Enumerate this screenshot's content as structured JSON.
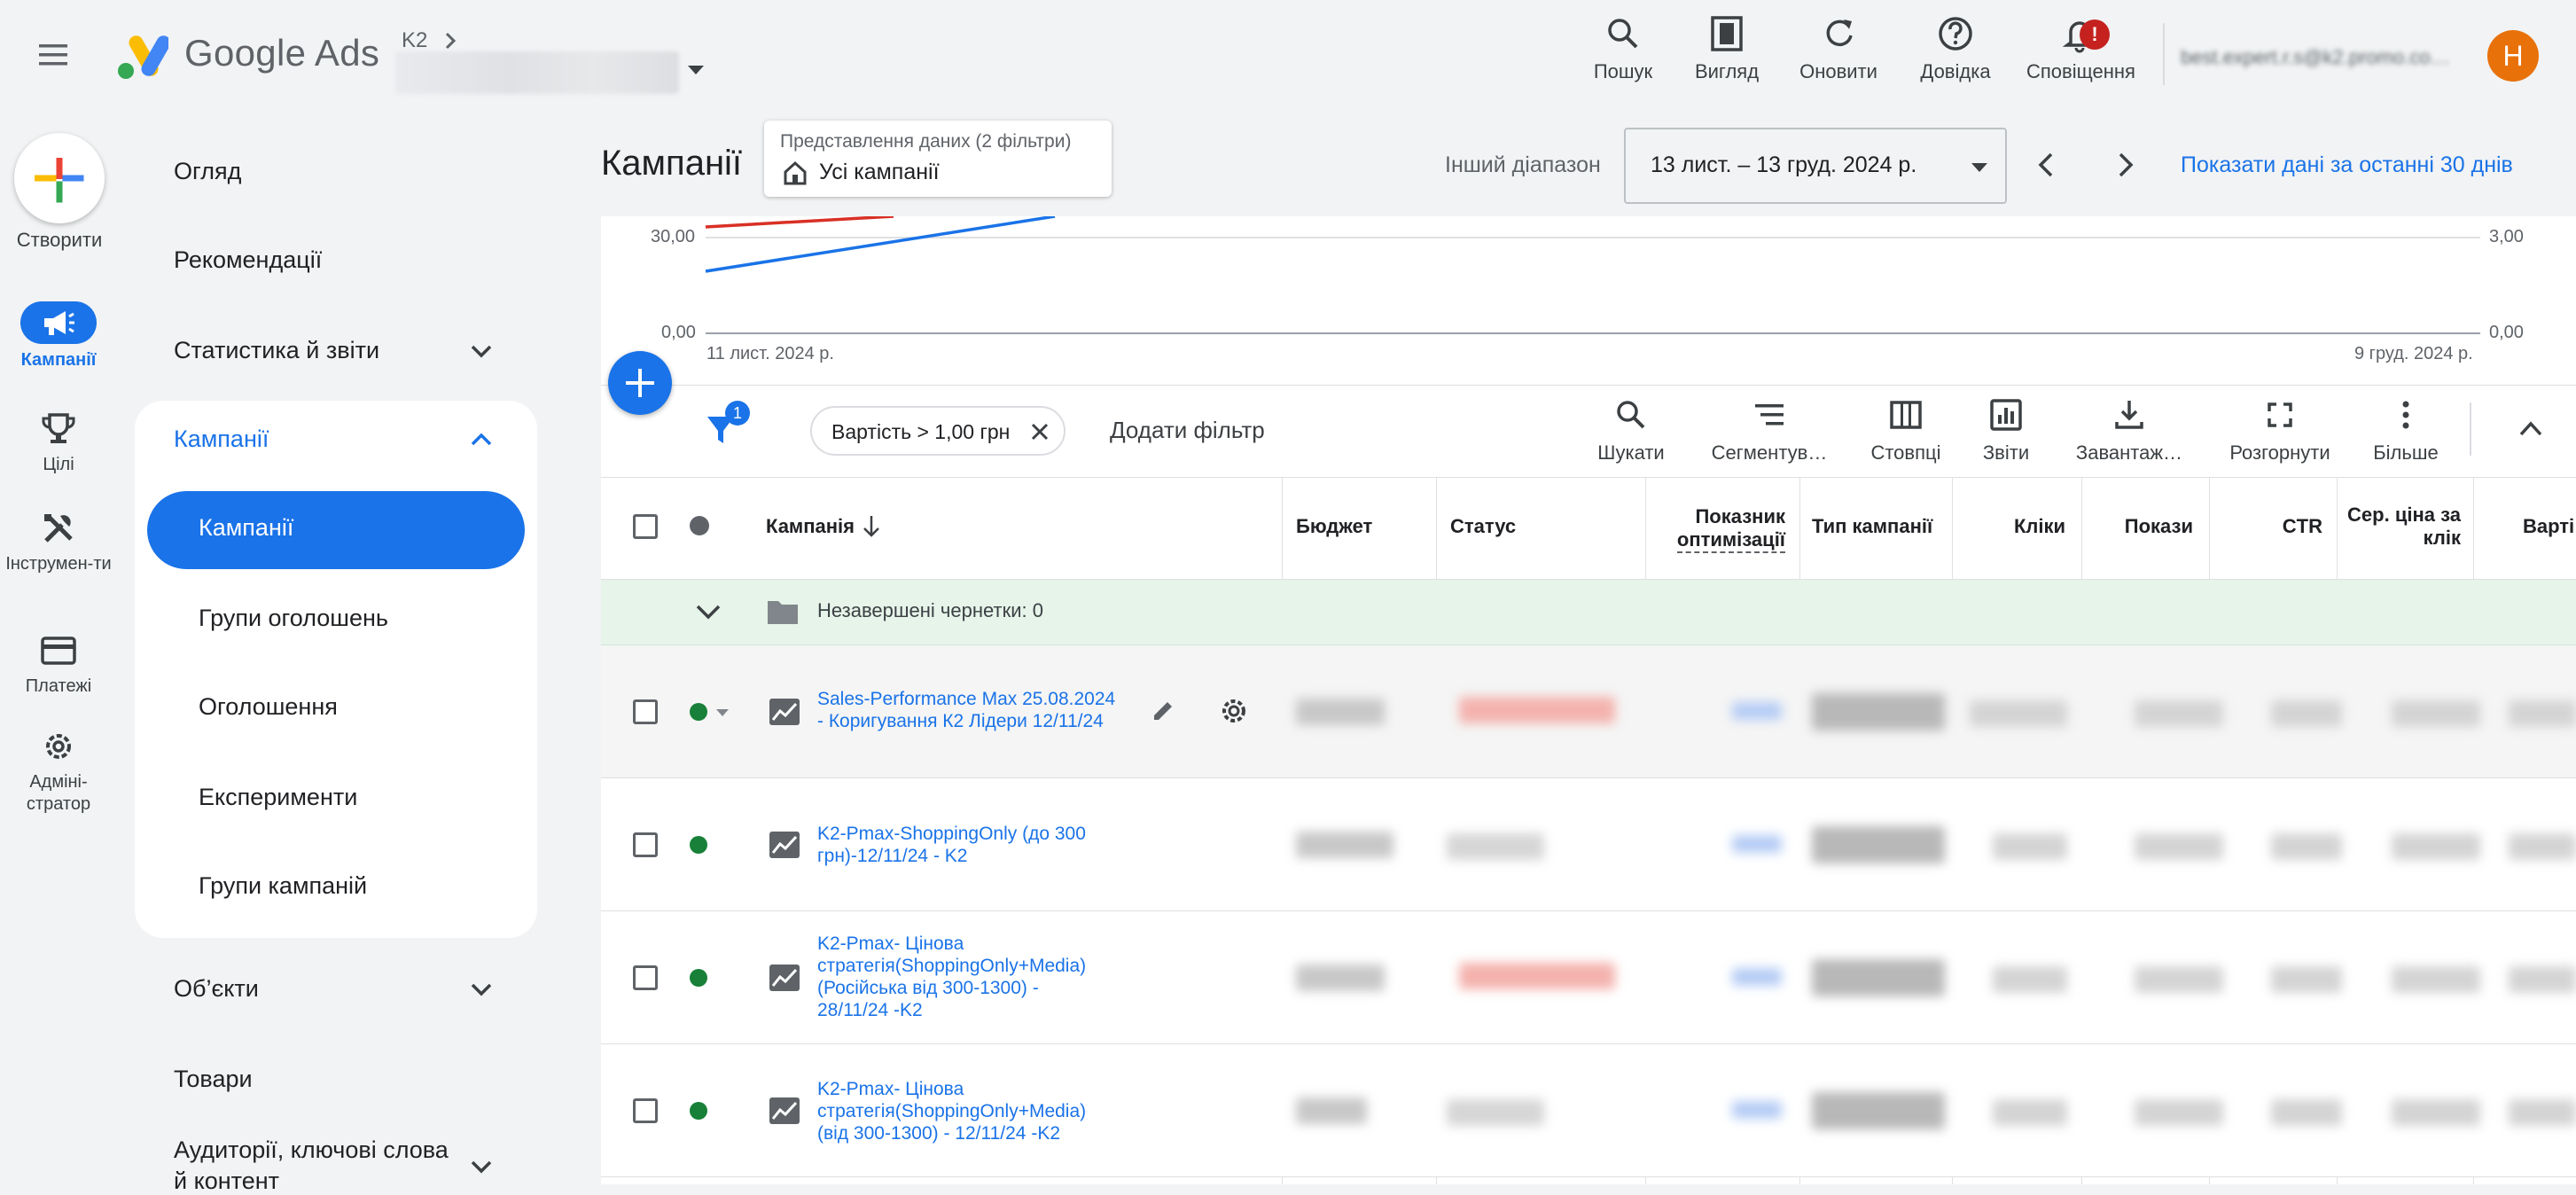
{
  "header": {
    "app_name": "Google Ads",
    "account_crumb": "K2",
    "tools": [
      {
        "label": "Пошук",
        "icon": "search-icon"
      },
      {
        "label": "Вигляд",
        "icon": "appearance-icon"
      },
      {
        "label": "Оновити",
        "icon": "refresh-icon"
      },
      {
        "label": "Довідка",
        "icon": "help-icon"
      },
      {
        "label": "Сповіщення",
        "icon": "notifications-icon"
      }
    ],
    "notif_badge": "!",
    "user_email": "best.expert.r.s@k2.promo.co…",
    "avatar_letter": "H"
  },
  "rail": {
    "create_label": "Створити",
    "items": [
      {
        "label": "Кампанії",
        "icon": "campaigns-icon"
      },
      {
        "label": "Цілі",
        "icon": "trophy-icon"
      },
      {
        "label": "Інструмен-ти",
        "icon": "tools-icon"
      },
      {
        "label": "Платежі",
        "icon": "card-icon"
      },
      {
        "label": "Адміні-стратор",
        "icon": "admin-gear-icon"
      }
    ]
  },
  "nav": {
    "overview": "Огляд",
    "recommendations": "Рекомендації",
    "stats": "Статистика й звіти",
    "campaigns_section": "Кампанії",
    "sub": [
      "Кампанії",
      "Групи оголошень",
      "Оголошення",
      "Експерименти",
      "Групи кампаній"
    ],
    "assets": "Об’єкти",
    "products": "Товари",
    "audiences_line1": "Аудиторії, ключові слова",
    "audiences_line2": "й контент"
  },
  "main": {
    "title": "Кампанії",
    "view_chip_caption": "Представлення даних (2 фільтри)",
    "view_chip_value": "Усі кампанії",
    "range_label": "Інший діапазон",
    "date_range": "13 лист. – 13 груд. 2024 р.",
    "show_30": "Показати дані за останні 30 днів"
  },
  "chart": {
    "left_ticks": [
      "30,00",
      "0,00"
    ],
    "right_ticks": [
      "3,00",
      "0,00"
    ],
    "x_start": "11 лист. 2024 р.",
    "x_end": "9 груд. 2024 р.",
    "series_colors": [
      "#d93025",
      "#1a73e8"
    ]
  },
  "toolbar": {
    "filter_count": "1",
    "filter_chip": "Вартість > 1,00 грн",
    "add_filter": "Додати фільтр",
    "buttons": [
      {
        "label": "Шукати",
        "icon": "search-icon"
      },
      {
        "label": "Сегментув…",
        "icon": "segment-icon"
      },
      {
        "label": "Стовпці",
        "icon": "columns-icon"
      },
      {
        "label": "Звіти",
        "icon": "reports-icon"
      },
      {
        "label": "Завантаж…",
        "icon": "download-icon"
      },
      {
        "label": "Розгорнути",
        "icon": "expand-icon"
      },
      {
        "label": "Більше",
        "icon": "more-vert-icon"
      }
    ]
  },
  "table": {
    "columns": {
      "campaign": "Кампанія",
      "budget": "Бюджет",
      "status": "Статус",
      "opt_score_1": "Показник",
      "opt_score_2": "оптимізації",
      "type": "Тип кампанії",
      "clicks": "Кліки",
      "impressions": "Покази",
      "ctr": "CTR",
      "avg_cpc_1": "Сер. ціна за",
      "avg_cpc_2": "клік",
      "cost": "Варті"
    },
    "drafts": "Незавершені чернетки: 0",
    "rows": [
      {
        "l1": "Sales-Performance Max 25.08.2024",
        "l2": "- Коригування К2 Лідери 12/11/24",
        "l3": "",
        "l4": ""
      },
      {
        "l1": "K2-Pmax-ShoppingOnly (до 300",
        "l2": "грн)-12/11/24 - K2",
        "l3": "",
        "l4": ""
      },
      {
        "l1": "K2-Pmax- Цінова",
        "l2": "стратегія(ShoppingOnly+Media)",
        "l3": "(Російська від 300-1300) -",
        "l4": "28/11/24 -K2"
      },
      {
        "l1": "K2-Pmax- Цінова",
        "l2": "стратегія(ShoppingOnly+Media)",
        "l3": "(від 300-1300) - 12/11/24 -K2",
        "l4": ""
      }
    ]
  }
}
